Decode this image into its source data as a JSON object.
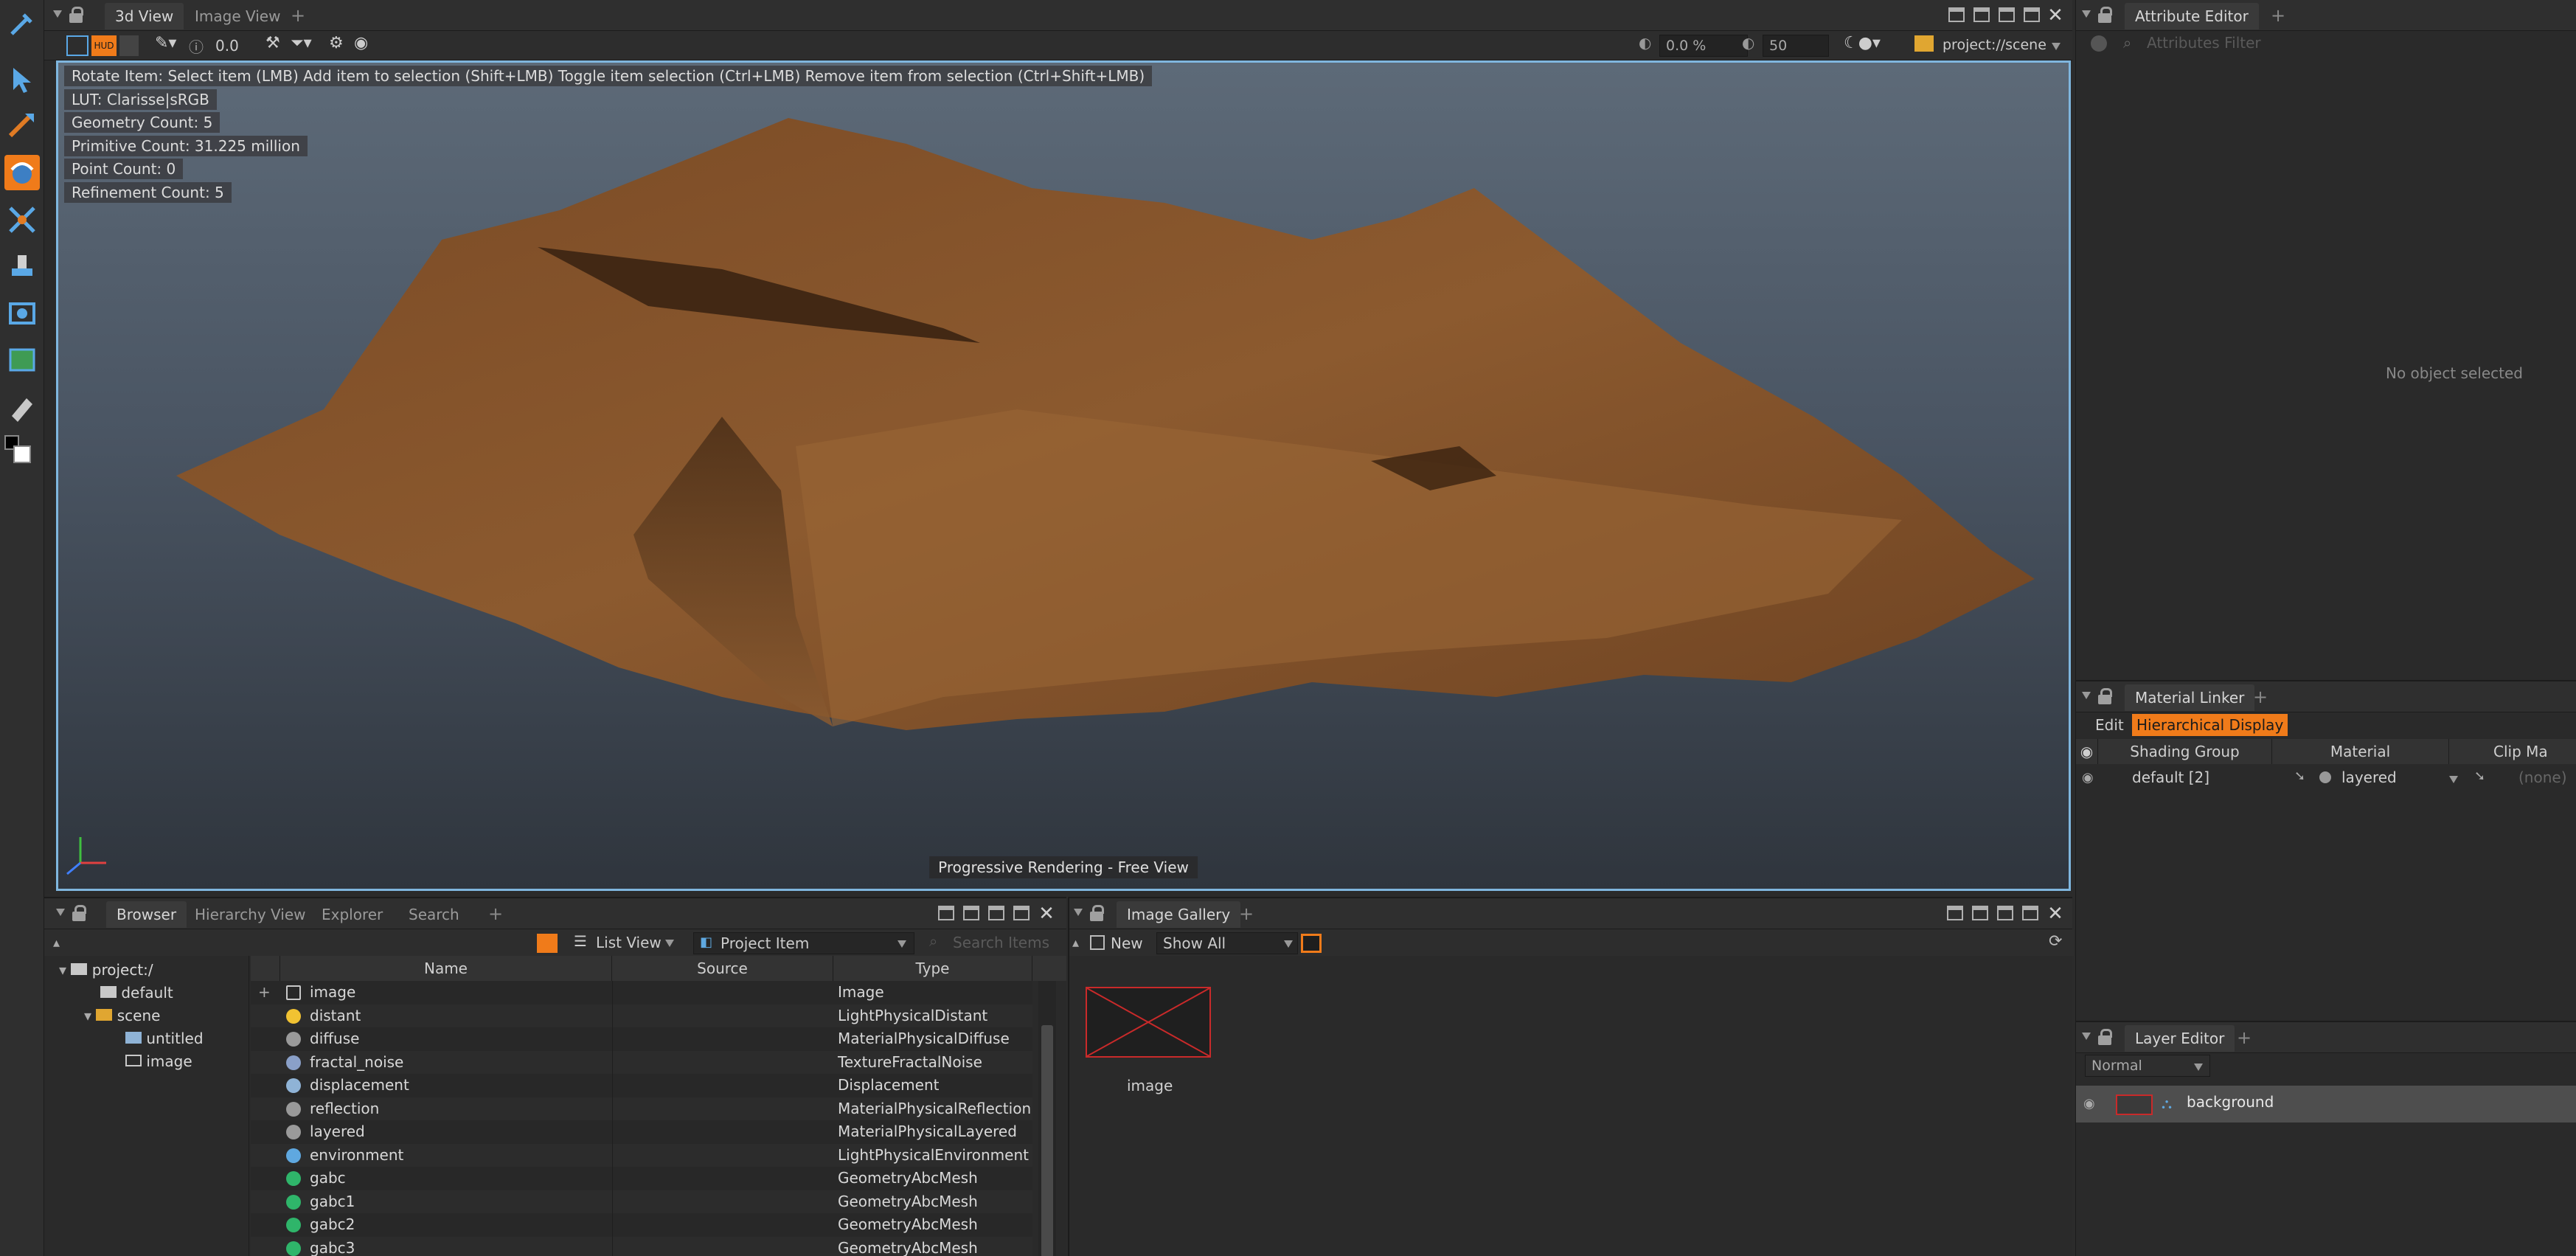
{
  "viewport_panel": {
    "tabs": [
      {
        "label": "3d View",
        "active": true
      },
      {
        "label": "Image View",
        "active": false
      }
    ],
    "toolbar": {
      "hud_label": "HUD",
      "value": "0.0",
      "percent": "0.0 %",
      "value2": "50",
      "context": "project://scene"
    },
    "hud_lines": [
      "Rotate Item: Select item (LMB)  Add item to selection (Shift+LMB)  Toggle item selection (Ctrl+LMB)  Remove item from selection (Ctrl+Shift+LMB)",
      "LUT: Clarisse|sRGB",
      "Geometry Count: 5",
      "Primitive Count: 31.225 million",
      "Point Count: 0",
      "Refinement Count: 5"
    ],
    "footer": "Progressive Rendering - Free View"
  },
  "attribute_editor": {
    "tab": "Attribute Editor",
    "filter_placeholder": "Attributes Filter",
    "empty_text": "No object selected"
  },
  "material_linker": {
    "tab": "Material Linker",
    "edit_label": "Edit",
    "mode_label": "Hierarchical Display",
    "columns": [
      "Shading Group",
      "Material",
      "Clip Ma"
    ],
    "row": {
      "group": "default [2]",
      "material": "layered",
      "clip": "(none)"
    }
  },
  "layer_editor": {
    "tab": "Layer Editor",
    "blend_mode": "Normal",
    "layer_name": "background"
  },
  "browser": {
    "tabs": [
      "Browser",
      "Hierarchy View",
      "Explorer",
      "Search"
    ],
    "view_mode": "List View",
    "filter": "Project Item",
    "search_placeholder": "Search Items",
    "tree": [
      {
        "label": "project:/",
        "depth": 0
      },
      {
        "label": "default",
        "depth": 1
      },
      {
        "label": "scene",
        "depth": 1
      },
      {
        "label": "untitled",
        "depth": 2
      },
      {
        "label": "image",
        "depth": 2
      }
    ],
    "columns": [
      "Name",
      "Source",
      "Type"
    ],
    "items": [
      {
        "name": "image",
        "type": "Image",
        "icon": "image-icon",
        "color": "#c8c8c8"
      },
      {
        "name": "distant",
        "type": "LightPhysicalDistant",
        "icon": "sun-icon",
        "color": "#f1c232"
      },
      {
        "name": "diffuse",
        "type": "MaterialPhysicalDiffuse",
        "icon": "material-sphere-icon",
        "color": "#9a9a9a"
      },
      {
        "name": "fractal_noise",
        "type": "TextureFractalNoise",
        "icon": "texture-icon",
        "color": "#8aa0c8"
      },
      {
        "name": "displacement",
        "type": "Displacement",
        "icon": "displacement-icon",
        "color": "#8fb3d6"
      },
      {
        "name": "reflection",
        "type": "MaterialPhysicalReflection",
        "icon": "material-sphere-icon",
        "color": "#9a9a9a"
      },
      {
        "name": "layered",
        "type": "MaterialPhysicalLayered",
        "icon": "material-sphere-icon",
        "color": "#9a9a9a"
      },
      {
        "name": "environment",
        "type": "LightPhysicalEnvironment",
        "icon": "environment-light-icon",
        "color": "#5fa8e0"
      },
      {
        "name": "gabc",
        "type": "GeometryAbcMesh",
        "icon": "geometry-icon",
        "color": "#2fb56a"
      },
      {
        "name": "gabc1",
        "type": "GeometryAbcMesh",
        "icon": "geometry-icon",
        "color": "#2fb56a"
      },
      {
        "name": "gabc2",
        "type": "GeometryAbcMesh",
        "icon": "geometry-icon",
        "color": "#2fb56a"
      },
      {
        "name": "gabc3",
        "type": "GeometryAbcMesh",
        "icon": "geometry-icon",
        "color": "#2fb56a"
      }
    ]
  },
  "image_gallery": {
    "tab": "Image Gallery",
    "new_label": "New",
    "filter": "Show All",
    "thumb_label": "image"
  }
}
